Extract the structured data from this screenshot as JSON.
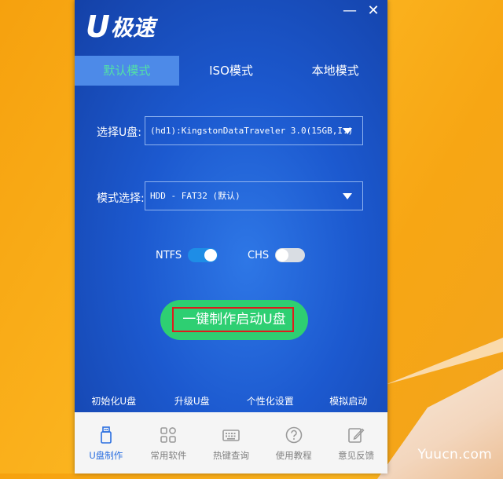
{
  "app": {
    "logo_u": "U",
    "logo_text": "极速",
    "window": {
      "minimize": "—",
      "close": "✕"
    },
    "tabs": [
      {
        "label": "默认模式",
        "active": true
      },
      {
        "label": "ISO模式",
        "active": false
      },
      {
        "label": "本地模式",
        "active": false
      }
    ],
    "usb_select": {
      "label": "选择U盘:",
      "value": "(hd1):KingstonDataTraveler 3.0(15GB,I:)"
    },
    "mode_select": {
      "label": "模式选择:",
      "value": "HDD - FAT32 (默认)"
    },
    "toggles": {
      "ntfs": {
        "label": "NTFS",
        "on": true
      },
      "chs": {
        "label": "CHS",
        "on": false
      }
    },
    "make_button": "一键制作启动U盘",
    "functions": [
      "初始化U盘",
      "升级U盘",
      "个性化设置",
      "模拟启动"
    ],
    "nav": [
      {
        "label": "U盘制作",
        "icon": "usb-drive-icon",
        "active": true
      },
      {
        "label": "常用软件",
        "icon": "apps-grid-icon",
        "active": false
      },
      {
        "label": "热键查询",
        "icon": "keyboard-icon",
        "active": false
      },
      {
        "label": "使用教程",
        "icon": "help-icon",
        "active": false
      },
      {
        "label": "意见反馈",
        "icon": "feedback-icon",
        "active": false
      }
    ],
    "colors": {
      "accent": "#2ecf72",
      "active_tab_text": "#52e0a7",
      "nav_active": "#2a6ee0"
    }
  },
  "watermark": "Yuucn.com"
}
